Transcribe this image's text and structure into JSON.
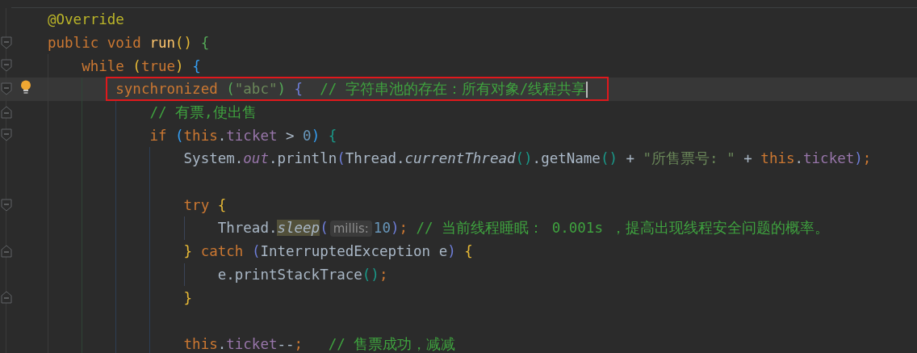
{
  "editor": {
    "lines": [
      {
        "kind": "line",
        "current": false,
        "bulb": false,
        "boxed": false,
        "caret": false,
        "tokens": [
          {
            "text": "@Override",
            "kind": "annotation"
          }
        ]
      },
      {
        "kind": "block",
        "current": false,
        "bulb": false,
        "boxed": false,
        "caret": false,
        "tokens": [
          {
            "text": "public void ",
            "kind": "keyword"
          },
          {
            "text": "run",
            "kind": "method"
          },
          {
            "text": "()",
            "kind": "bracket_1"
          },
          {
            "text": " {",
            "kind": "bracket_2"
          }
        ],
        "children": [
          {
            "kind": "block",
            "current": false,
            "bulb": false,
            "boxed": false,
            "caret": false,
            "tokens": [
              {
                "text": "while ",
                "kind": "keyword"
              },
              {
                "text": "(",
                "kind": "bracket_1"
              },
              {
                "text": "true",
                "kind": "keyword"
              },
              {
                "text": ")",
                "kind": "bracket_1"
              },
              {
                "text": " {",
                "kind": "bracket_3"
              }
            ],
            "children": [
              {
                "kind": "block",
                "current": true,
                "bulb": true,
                "boxed": true,
                "caret": true,
                "tokens": [
                  {
                    "text": "synchronized ",
                    "kind": "keyword"
                  },
                  {
                    "text": "(",
                    "kind": "bracket_2"
                  },
                  {
                    "text": "\"abc\"",
                    "kind": "string"
                  },
                  {
                    "text": ")",
                    "kind": "bracket_2"
                  },
                  {
                    "text": " {",
                    "kind": "bracket_4"
                  },
                  {
                    "text": "  // 字符串池的存在：所有对象/线程共享",
                    "kind": "comment"
                  }
                ],
                "children": [
                  {
                    "kind": "block_end",
                    "current": false,
                    "bulb": false,
                    "boxed": false,
                    "caret": false,
                    "tokens": [
                      {
                        "text": "// 有票,使出售",
                        "kind": "comment"
                      }
                    ]
                  },
                  {
                    "kind": "block",
                    "current": false,
                    "bulb": false,
                    "boxed": false,
                    "caret": false,
                    "tokens": [
                      {
                        "text": "if ",
                        "kind": "keyword"
                      },
                      {
                        "text": "(",
                        "kind": "bracket_3"
                      },
                      {
                        "text": "this",
                        "kind": "keyword"
                      },
                      {
                        "text": ".",
                        "kind": "plain"
                      },
                      {
                        "text": "ticket",
                        "kind": "field"
                      },
                      {
                        "text": " > ",
                        "kind": "plain"
                      },
                      {
                        "text": "0",
                        "kind": "number"
                      },
                      {
                        "text": ")",
                        "kind": "bracket_3"
                      },
                      {
                        "text": " {",
                        "kind": "bracket_5"
                      }
                    ],
                    "children": [
                      {
                        "kind": "line",
                        "current": false,
                        "bulb": false,
                        "boxed": false,
                        "caret": false,
                        "tokens": [
                          {
                            "text": "System.",
                            "kind": "plain"
                          },
                          {
                            "text": "out",
                            "kind": "static_field"
                          },
                          {
                            "text": ".println",
                            "kind": "plain"
                          },
                          {
                            "text": "(",
                            "kind": "bracket_4"
                          },
                          {
                            "text": "Thread.",
                            "kind": "plain"
                          },
                          {
                            "text": "currentThread",
                            "kind": "static_method"
                          },
                          {
                            "text": "()",
                            "kind": "bracket_5"
                          },
                          {
                            "text": ".getName",
                            "kind": "plain"
                          },
                          {
                            "text": "()",
                            "kind": "bracket_5"
                          },
                          {
                            "text": " + ",
                            "kind": "plain"
                          },
                          {
                            "text": "\"所售票号: \"",
                            "kind": "string"
                          },
                          {
                            "text": " + ",
                            "kind": "plain"
                          },
                          {
                            "text": "this",
                            "kind": "keyword"
                          },
                          {
                            "text": ".",
                            "kind": "plain"
                          },
                          {
                            "text": "ticket",
                            "kind": "field"
                          },
                          {
                            "text": ")",
                            "kind": "bracket_4"
                          },
                          {
                            "text": ";",
                            "kind": "keyword"
                          }
                        ]
                      },
                      {
                        "kind": "blank",
                        "current": false,
                        "bulb": false,
                        "boxed": false,
                        "caret": false
                      },
                      {
                        "kind": "block",
                        "current": false,
                        "bulb": false,
                        "boxed": false,
                        "caret": false,
                        "tokens": [
                          {
                            "text": "try ",
                            "kind": "keyword"
                          },
                          {
                            "text": "{",
                            "kind": "bracket_1"
                          }
                        ],
                        "children": [
                          {
                            "kind": "line",
                            "current": false,
                            "bulb": false,
                            "boxed": false,
                            "caret": false,
                            "tokens": [
                              {
                                "text": "Thread.",
                                "kind": "plain"
                              },
                              {
                                "text": "sleep",
                                "kind": "static_method_marked"
                              },
                              {
                                "text": "(",
                                "kind": "bracket_4"
                              },
                              {
                                "text": "millis:",
                                "kind": "hint"
                              },
                              {
                                "text": "10",
                                "kind": "number"
                              },
                              {
                                "text": ")",
                                "kind": "bracket_4"
                              },
                              {
                                "text": "; ",
                                "kind": "keyword"
                              },
                              {
                                "text": "// 当前线程睡眠： 0.001s ，提高出现线程安全问题的概率。",
                                "kind": "comment"
                              }
                            ]
                          }
                        ]
                      },
                      {
                        "kind": "block_end",
                        "current": false,
                        "bulb": false,
                        "boxed": false,
                        "caret": false,
                        "tokens": [
                          {
                            "text": "}",
                            "kind": "bracket_1"
                          },
                          {
                            "text": " catch ",
                            "kind": "keyword"
                          },
                          {
                            "text": "(",
                            "kind": "bracket_4"
                          },
                          {
                            "text": "InterruptedException e",
                            "kind": "plain"
                          },
                          {
                            "text": ")",
                            "kind": "bracket_4"
                          },
                          {
                            "text": " {",
                            "kind": "bracket_1"
                          }
                        ],
                        "children": [
                          {
                            "kind": "line",
                            "current": false,
                            "bulb": false,
                            "boxed": false,
                            "caret": false,
                            "tokens": [
                              {
                                "text": "e.printStackTrace",
                                "kind": "plain"
                              },
                              {
                                "text": "()",
                                "kind": "bracket_5"
                              },
                              {
                                "text": ";",
                                "kind": "keyword"
                              }
                            ]
                          }
                        ]
                      },
                      {
                        "kind": "block_end",
                        "current": false,
                        "bulb": false,
                        "boxed": false,
                        "caret": false,
                        "tokens": [
                          {
                            "text": "}",
                            "kind": "bracket_1"
                          }
                        ]
                      },
                      {
                        "kind": "blank",
                        "current": false,
                        "bulb": false,
                        "boxed": false,
                        "caret": false
                      },
                      {
                        "kind": "line",
                        "current": false,
                        "bulb": false,
                        "boxed": false,
                        "caret": false,
                        "tokens": [
                          {
                            "text": "this",
                            "kind": "keyword"
                          },
                          {
                            "text": ".",
                            "kind": "plain"
                          },
                          {
                            "text": "ticket",
                            "kind": "field"
                          },
                          {
                            "text": "--",
                            "kind": "plain"
                          },
                          {
                            "text": ";",
                            "kind": "keyword"
                          },
                          {
                            "text": "   // 售票成功，减减",
                            "kind": "comment"
                          }
                        ]
                      }
                    ]
                  }
                ]
              }
            ]
          }
        ]
      }
    ]
  }
}
